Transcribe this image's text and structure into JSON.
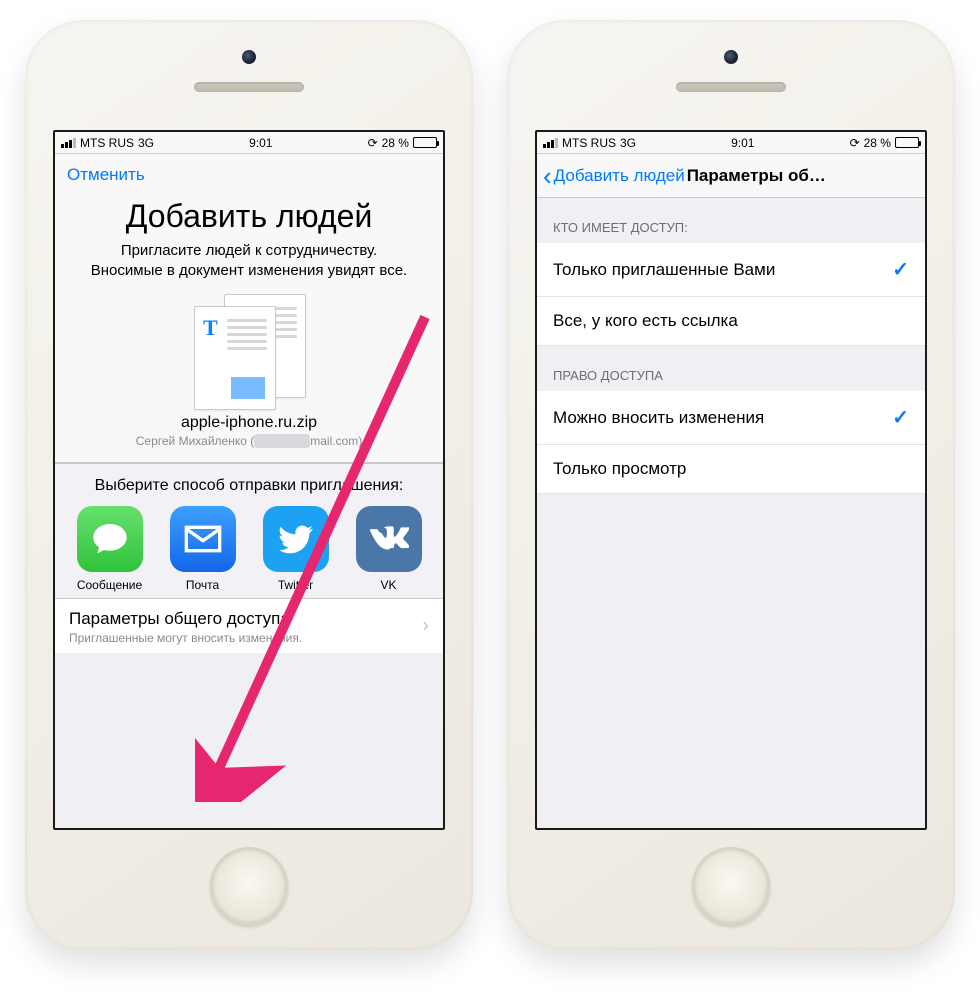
{
  "status": {
    "carrier": "MTS RUS",
    "network": "3G",
    "time": "9:01",
    "battery_pct": "28 %"
  },
  "left": {
    "cancel": "Отменить",
    "title": "Добавить людей",
    "subtitle": "Пригласите людей к сотрудничеству. Вносимые в документ изменения увидят все.",
    "file_name": "apple-iphone.ru.zip",
    "owner_prefix": "Сергей Михайленко (",
    "owner_suffix": "mail.com)",
    "share_header": "Выберите способ отправки приглашения:",
    "share": {
      "msg": "Сообщение",
      "mail": "Почта",
      "twitter": "Twitter",
      "vk": "VK"
    },
    "row_title": "Параметры общего доступа",
    "row_sub": "Приглашенные могут вносить изменения."
  },
  "right": {
    "back": "Добавить людей",
    "title": "Параметры об…",
    "group1": "КТО ИМЕЕТ ДОСТУП:",
    "opt1": "Только приглашенные Вами",
    "opt2": "Все, у кого есть ссылка",
    "group2": "ПРАВО ДОСТУПА",
    "opt3": "Можно вносить изменения",
    "opt4": "Только просмотр"
  }
}
